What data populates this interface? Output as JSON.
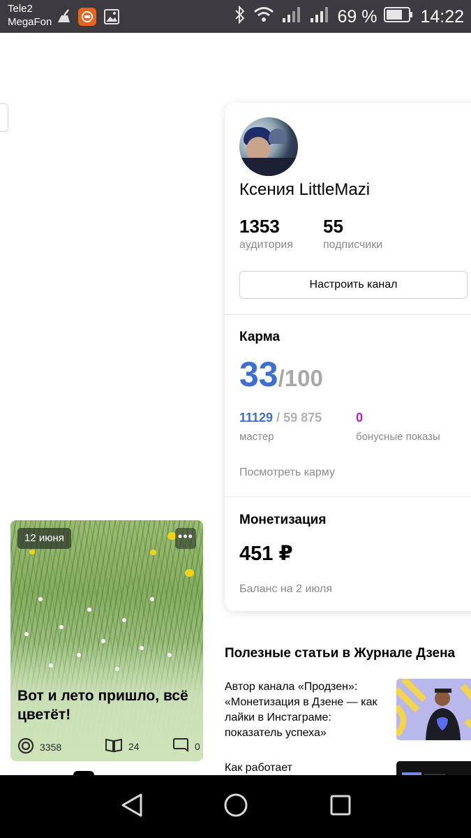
{
  "status_bar": {
    "carrier_1": "Tele2",
    "carrier_2": "MegaFon",
    "battery_percent": "69 %",
    "time": "14:22",
    "icons": [
      "cleaner-icon",
      "app-notification-icon",
      "gallery-icon",
      "bluetooth-icon",
      "wifi-icon",
      "signal-icon",
      "signal-icon",
      "battery-icon"
    ],
    "notification_accent": "#e8641c"
  },
  "channel": {
    "name": "Ксения LittleMazi",
    "audience_value": "1353",
    "audience_label": "аудитория",
    "subscribers_value": "55",
    "subscribers_label": "подписчики",
    "setup_button": "Настроить канал"
  },
  "karma": {
    "title": "Карма",
    "score": "33",
    "score_max": "/100",
    "progress_current": "11129",
    "progress_total": "59 875",
    "progress_separator": "/",
    "progress_label": "мастер",
    "bonus_value": "0",
    "bonus_label": "бонусные показы",
    "view_link": "Посмотреть карму",
    "accent": "#3c6fd6",
    "bonus_color": "#b023d9"
  },
  "monetization": {
    "title": "Монетизация",
    "amount": "451 ₽",
    "balance_label": "Баланс на 2 июля"
  },
  "article": {
    "date": "12 июня",
    "more_label": "•••",
    "title": "Вот и лето пришло, всё цветёт!",
    "views": "3358",
    "reads": "24",
    "comments": "0"
  },
  "useful_articles": {
    "heading": "Полезные статьи в Журнале Дзена",
    "items": [
      {
        "title": "Автор канала «Продзен»: «Монетизация в Дзене — как лайки в Инстаграме: показатель успеха»"
      },
      {
        "title": "Как работает"
      }
    ]
  },
  "nav_bar": {
    "buttons": [
      "back-icon",
      "home-icon",
      "recents-icon"
    ]
  }
}
